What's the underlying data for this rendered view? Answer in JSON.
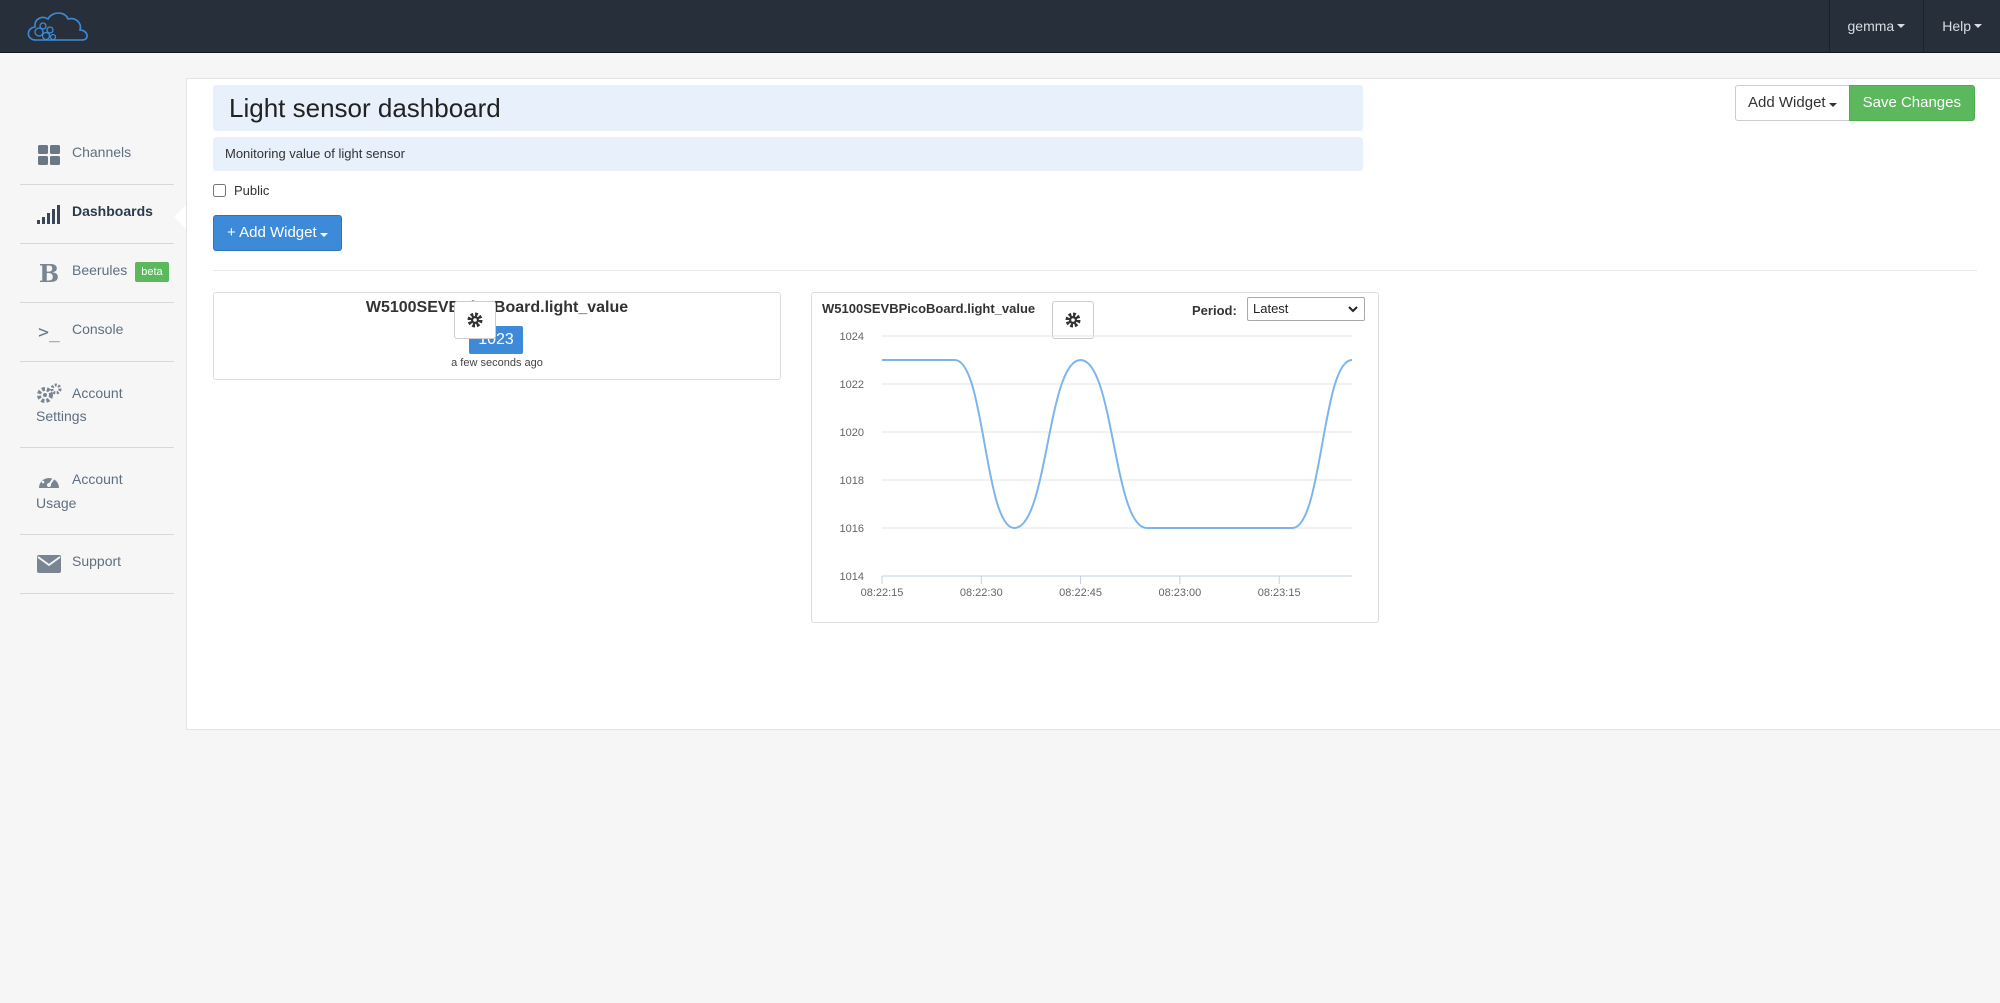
{
  "nav": {
    "user_label": "gemma",
    "help_label": "Help"
  },
  "sidebar": {
    "items": [
      {
        "label": "Channels",
        "icon": "grid-icon"
      },
      {
        "label": "Dashboards",
        "icon": "signal-bars-icon",
        "active": true
      },
      {
        "label": "Beerules",
        "icon": "beerules-b-icon",
        "badge": "beta"
      },
      {
        "label": "Console",
        "icon": "console-prompt-icon"
      },
      {
        "label": "Account Settings",
        "icon": "gears-icon"
      },
      {
        "label": "Account Usage",
        "icon": "gauge-icon"
      },
      {
        "label": "Support",
        "icon": "envelope-icon"
      }
    ]
  },
  "dashboard": {
    "title": "Light sensor dashboard",
    "description": "Monitoring value of light sensor",
    "public_label": "Public",
    "public_checked": false,
    "add_widget_label": "+ Add Widget",
    "top_add_widget_label": "Add Widget",
    "save_label": "Save Changes"
  },
  "widget_value": {
    "title": "W5100SEVBPicoBoard.light_value",
    "value": "1023",
    "time": "a few seconds ago"
  },
  "widget_chart": {
    "title": "W5100SEVBPicoBoard.light_value",
    "period_label": "Period:",
    "period_value": "Latest"
  },
  "colors": {
    "accent": "#3d8bd8",
    "save": "#5cb85c",
    "line": "#7cb5ec",
    "navbar": "#262f3a"
  },
  "chart_data": {
    "type": "line",
    "title": "",
    "xlabel": "",
    "ylabel": "",
    "ylim": [
      1014,
      1024
    ],
    "yticks": [
      1014,
      1016,
      1018,
      1020,
      1022,
      1024
    ],
    "xticks": [
      "08:22:15",
      "08:22:30",
      "08:22:45",
      "08:23:00",
      "08:23:15"
    ],
    "xlim": [
      "08:22:15",
      "08:23:26"
    ],
    "grid": true,
    "series": [
      {
        "x": [
          "08:22:15",
          "08:22:26",
          "08:22:35",
          "08:22:45",
          "08:22:55",
          "08:23:17",
          "08:23:26"
        ],
        "y": [
          1023,
          1023,
          1016,
          1023,
          1016,
          1016,
          1023
        ]
      }
    ]
  }
}
